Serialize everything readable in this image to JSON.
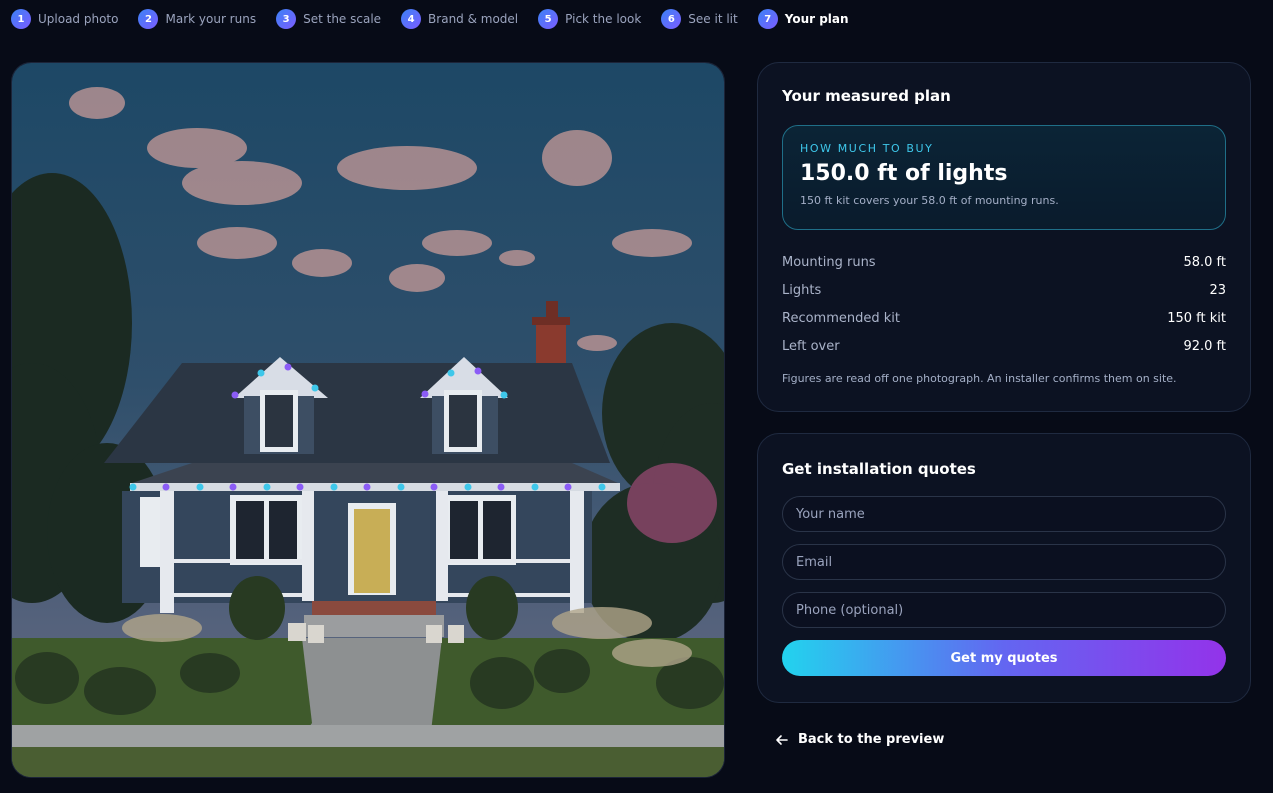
{
  "steps": [
    {
      "num": "1",
      "label": "Upload photo"
    },
    {
      "num": "2",
      "label": "Mark your runs"
    },
    {
      "num": "3",
      "label": "Set the scale"
    },
    {
      "num": "4",
      "label": "Brand & model"
    },
    {
      "num": "5",
      "label": "Pick the look"
    },
    {
      "num": "6",
      "label": "See it lit"
    },
    {
      "num": "7",
      "label": "Your plan"
    }
  ],
  "plan": {
    "title": "Your measured plan",
    "eyebrow": "HOW MUCH TO BUY",
    "amount": "150.0 ft of lights",
    "note": "150 ft kit covers your 58.0 ft of mounting runs.",
    "rows": [
      {
        "label": "Mounting runs",
        "value": "58.0 ft"
      },
      {
        "label": "Lights",
        "value": "23"
      },
      {
        "label": "Recommended kit",
        "value": "150 ft kit"
      },
      {
        "label": "Left over",
        "value": "92.0 ft"
      }
    ],
    "footnote": "Figures are read off one photograph. An installer confirms them on site."
  },
  "quote": {
    "title": "Get installation quotes",
    "name_placeholder": "Your name",
    "email_placeholder": "Email",
    "phone_placeholder": "Phone (optional)",
    "submit_label": "Get my quotes"
  },
  "back": {
    "label": "Back to the preview",
    "icon": "arrow-left-icon"
  },
  "colors": {
    "accent_cyan": "#22d3ee",
    "accent_purple": "#9333ea",
    "light_cyan": "#3ec7ea",
    "light_purple": "#8b5cf6"
  }
}
